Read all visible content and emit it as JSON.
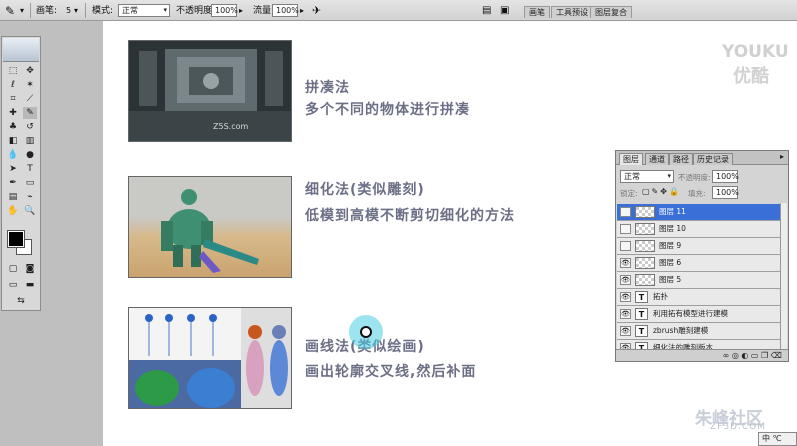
{
  "options_bar": {
    "brush_label": "画笔:",
    "brush_size": "5",
    "mode_label": "模式:",
    "mode_value": "正常",
    "opacity_label": "不透明度:",
    "opacity_value": "100%",
    "flow_label": "流量:",
    "flow_value": "100%",
    "panel_tabs": [
      "画笔",
      "工具预设",
      "图层复合"
    ]
  },
  "slides": [
    {
      "title": "拼凑法",
      "subtitle": "多个不同的物体进行拼凑"
    },
    {
      "title": "细化法(类似雕刻)",
      "subtitle": "低模到高模不断剪切细化的方法"
    },
    {
      "title": "画线法(类似绘画)",
      "subtitle": "画出轮廓交叉线,然后补面"
    }
  ],
  "thumbnail_caption": "Z5S.com",
  "layers_panel": {
    "tabs": [
      "图层",
      "通道",
      "路径",
      "历史记录"
    ],
    "blend_mode": "正常",
    "opacity_label": "不透明度:",
    "opacity_value": "100%",
    "lock_label": "锁定:",
    "fill_label": "填充:",
    "fill_value": "100%",
    "layers": [
      {
        "name": "图层 11",
        "type": "pixel",
        "visible": false,
        "selected": true
      },
      {
        "name": "图层 10",
        "type": "pixel",
        "visible": false,
        "selected": false
      },
      {
        "name": "图层 9",
        "type": "pixel",
        "visible": false,
        "selected": false
      },
      {
        "name": "图层 6",
        "type": "pixel",
        "visible": true,
        "selected": false
      },
      {
        "name": "图层 5",
        "type": "pixel",
        "visible": true,
        "selected": false
      },
      {
        "name": "拓扑",
        "type": "text",
        "visible": true,
        "selected": false
      },
      {
        "name": "利用拓有模型进行建模",
        "type": "text",
        "visible": true,
        "selected": false
      },
      {
        "name": "zbrush雕刻建模",
        "type": "text",
        "visible": true,
        "selected": false
      },
      {
        "name": "细化法的雕刻版本",
        "type": "text",
        "visible": true,
        "selected": false
      }
    ]
  },
  "watermarks": {
    "youku_en": "YOUKU",
    "youku_cn": "优酷",
    "zhufeng_cn": "朱峰社区",
    "zhufeng_url": "ZF3D.COM"
  },
  "ime_status": "中 ℃"
}
